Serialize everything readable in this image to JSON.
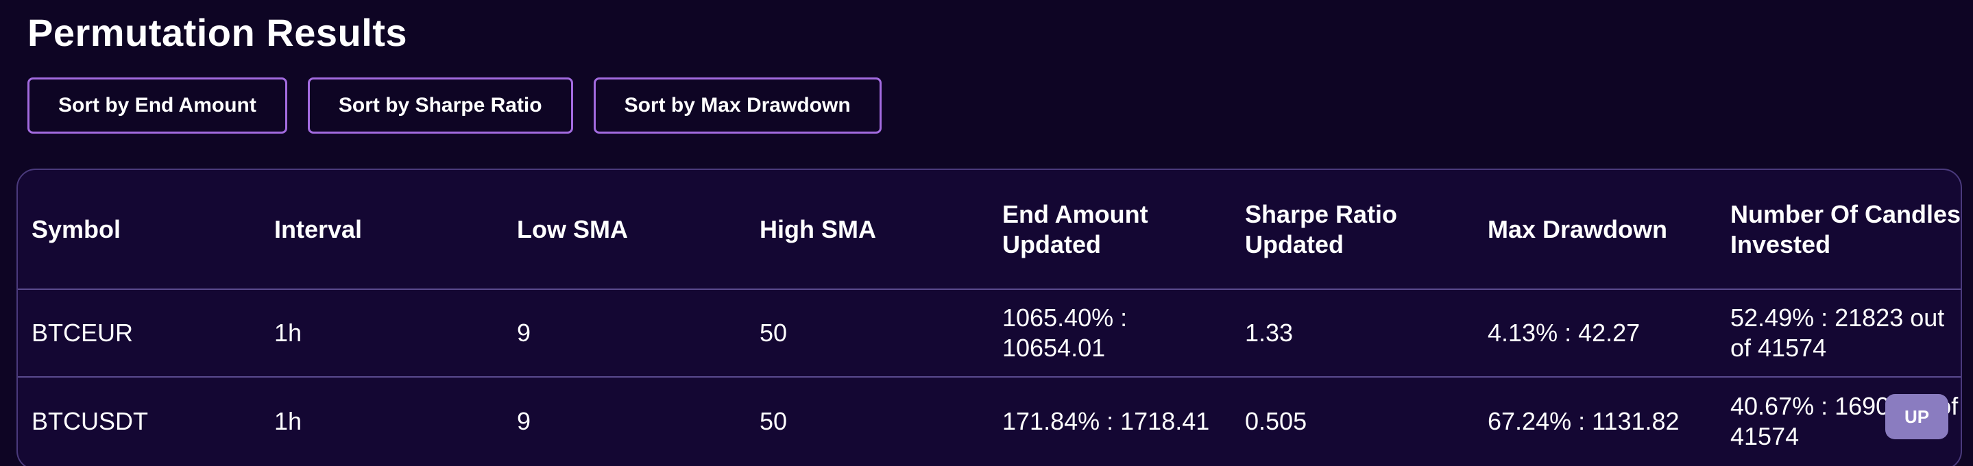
{
  "page": {
    "title": "Permutation Results"
  },
  "sort_buttons": [
    {
      "label": "Sort by End Amount"
    },
    {
      "label": "Sort by Sharpe Ratio"
    },
    {
      "label": "Sort by Max Drawdown"
    }
  ],
  "table": {
    "headers": [
      "Symbol",
      "Interval",
      "Low SMA",
      "High SMA",
      "End Amount Updated",
      "Sharpe Ratio Updated",
      "Max Drawdown",
      "Number Of Candles Invested"
    ],
    "rows": [
      {
        "symbol": "BTCEUR",
        "interval": "1h",
        "low_sma": "9",
        "high_sma": "50",
        "end_amount": "1065.40% : 10654.01",
        "sharpe_ratio": "1.33",
        "max_drawdown": "4.13% : 42.27",
        "candles_invested": "52.49% : 21823 out of 41574"
      },
      {
        "symbol": "BTCUSDT",
        "interval": "1h",
        "low_sma": "9",
        "high_sma": "50",
        "end_amount": "171.84% : 1718.41",
        "sharpe_ratio": "0.505",
        "max_drawdown": "67.24% : 1131.82",
        "candles_invested": "40.67% : 1690 out of 41574"
      }
    ]
  },
  "up_button": {
    "label": "UP"
  },
  "colors": {
    "background": "#0e0524",
    "table_background": "#140733",
    "button_border": "#a36be0",
    "up_button": "#8a7cc0"
  }
}
